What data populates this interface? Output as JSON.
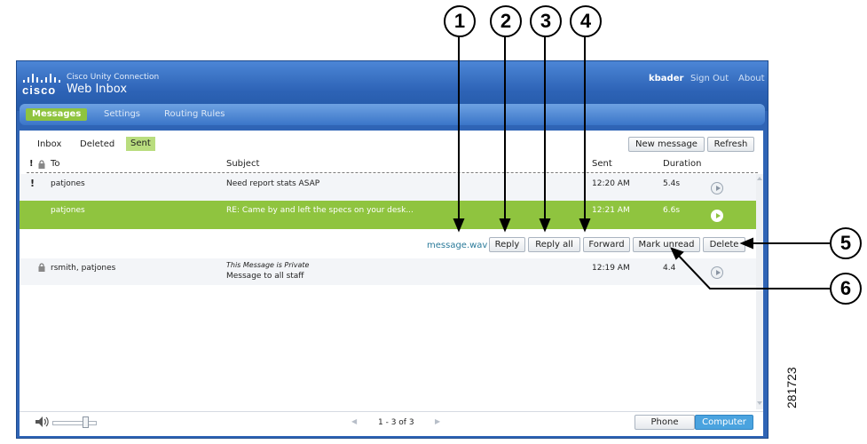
{
  "callouts": [
    "1",
    "2",
    "3",
    "4",
    "5",
    "6"
  ],
  "figure_id": "281723",
  "app": {
    "brand": "cisco",
    "product": "Cisco Unity Connection",
    "title": "Web Inbox",
    "user": "kbader",
    "sign_out": "Sign Out",
    "about": "About"
  },
  "nav": {
    "messages": "Messages",
    "settings": "Settings",
    "routing": "Routing Rules"
  },
  "folders": {
    "inbox": "Inbox",
    "deleted": "Deleted",
    "sent": "Sent"
  },
  "toolbar": {
    "new_message": "New message",
    "refresh": "Refresh"
  },
  "columns": {
    "priority": "!",
    "to": "To",
    "subject": "Subject",
    "sent": "Sent",
    "duration": "Duration"
  },
  "messages": [
    {
      "priority": "!",
      "to": "patjones",
      "private_note": "",
      "subject": "Need report stats ASAP",
      "sent": "12:20 AM",
      "duration": "5.4s"
    },
    {
      "priority": "",
      "to": "patjones",
      "private_note": "",
      "subject": "RE: Came by and left the specs on your desk...",
      "sent": "12:21 AM",
      "duration": "6.6s"
    },
    {
      "priority": "",
      "to": "rsmith, patjones",
      "private_note": "This Message is Private",
      "subject": "Message to all staff",
      "sent": "12:19 AM",
      "duration": "4.4"
    }
  ],
  "actions": {
    "attachment": "message.wav",
    "reply": "Reply",
    "reply_all": "Reply all",
    "forward": "Forward",
    "mark_unread": "Mark unread",
    "delete": "Delete"
  },
  "footer": {
    "pagination": "1 - 3 of 3",
    "phone": "Phone",
    "computer": "Computer",
    "volume_level": 0.8
  },
  "colors": {
    "accent_green": "#8fc43f",
    "header_blue": "#2f64b5",
    "link_teal": "#2a7a9a"
  }
}
